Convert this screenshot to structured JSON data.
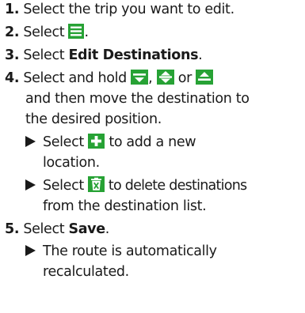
{
  "steps": [
    {
      "num": "1.",
      "text": "Select the trip you want to edit."
    },
    {
      "num": "2.",
      "text_before": "Select ",
      "icon": "menu-icon",
      "text_after": "."
    },
    {
      "num": "3.",
      "text_before": "Select ",
      "bold": "Edit Destinations",
      "text_after": "."
    },
    {
      "num": "4.",
      "text_before": "Select and hold ",
      "sep1": ", ",
      "sep2": " or ",
      "icons": [
        "move-middle-icon",
        "move-up-down-icon",
        "move-top-icon"
      ],
      "cont1": "and then move the destination to",
      "cont2": "the desired position.",
      "sub": [
        {
          "text_before": "Select ",
          "icon": "add-icon",
          "text_after": " to add a new",
          "cont": "location."
        },
        {
          "text_before": "Select ",
          "icon": "delete-icon",
          "text_after": " to delete destinations",
          "cont": "from the destination list."
        }
      ]
    },
    {
      "num": "5.",
      "text_before": "Select ",
      "bold": "Save",
      "text_after": ".",
      "sub": [
        {
          "text": "The route is automatically",
          "cont": "recalculated."
        }
      ]
    }
  ],
  "colors": {
    "icon_green": "#27a235",
    "text": "#1a1a1a"
  }
}
